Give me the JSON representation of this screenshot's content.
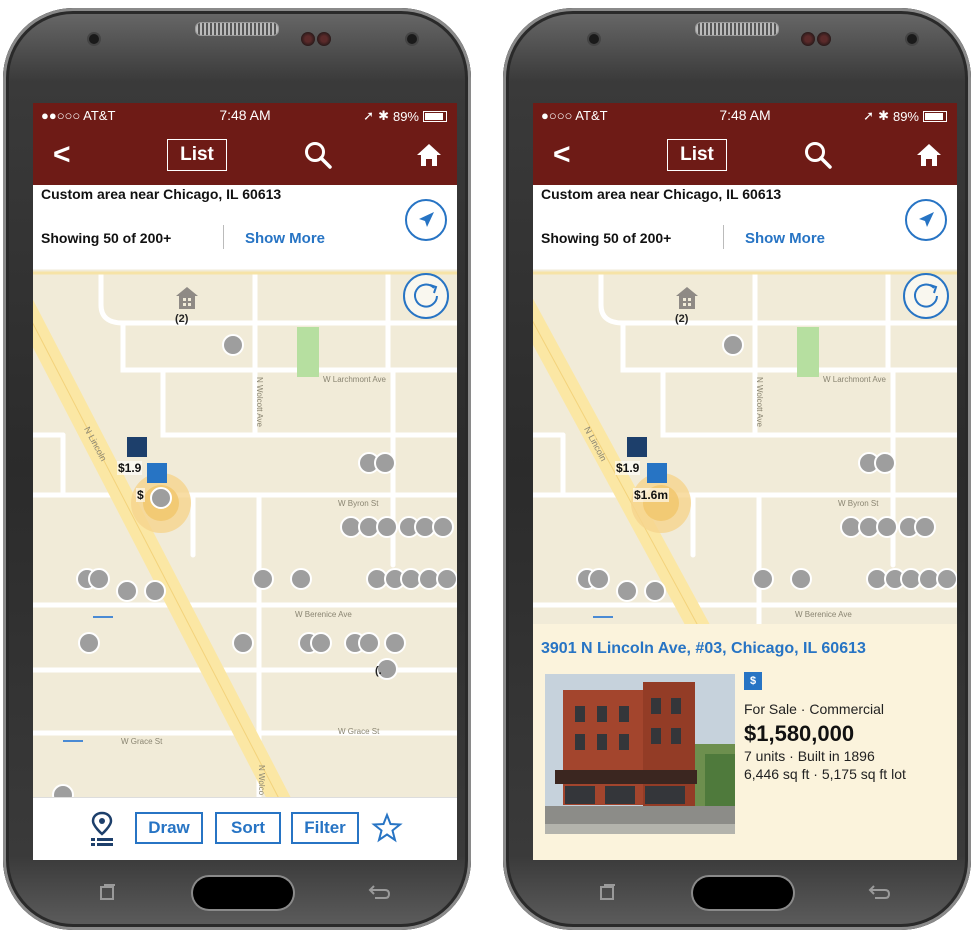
{
  "phones": [
    {
      "status": {
        "carrier": "●●○○○ AT&T",
        "time": "7:48 AM",
        "battery": "89%"
      },
      "nav": {
        "back": "<",
        "list_label": "List"
      },
      "info": {
        "title": "Custom area near Chicago, IL 60613",
        "count": "Showing 50 of 200+",
        "more": "Show More"
      },
      "map": {
        "cluster_count": "(2)",
        "price_1": "$1.9",
        "price_2": "$",
        "partial_label": "(.",
        "streets": {
          "larchmont": "W Larchmont Ave",
          "byron": "W Byron St",
          "berenice": "W Berenice Ave",
          "grace_a": "W Grace St",
          "grace_b": "W Grace St",
          "lincoln": "N Lincoln",
          "wolcott": "N Wolcott Ave",
          "wolcott_b": "N Wolco"
        }
      },
      "toolbar": {
        "draw": "Draw",
        "sort": "Sort",
        "filter": "Filter"
      }
    },
    {
      "status": {
        "carrier": "●○○○ AT&T",
        "time": "7:48 AM",
        "battery": "89%"
      },
      "nav": {
        "back": "<",
        "list_label": "List"
      },
      "info": {
        "title": "Custom area near Chicago, IL 60613",
        "count": "Showing 50 of 200+",
        "more": "Show More"
      },
      "map": {
        "cluster_count": "(2)",
        "price_1": "$1.9",
        "price_2": "$1.6m",
        "streets": {
          "larchmont": "W Larchmont Ave",
          "byron": "W Byron St",
          "berenice": "W Berenice Ave",
          "lincoln": "N Lincoln",
          "wolcott": "N Wolcott Ave"
        }
      },
      "detail": {
        "address": "3901 N Lincoln Ave, #03, Chicago, IL 60613",
        "badge": "$",
        "type": "For Sale · Commercial",
        "price": "$1,580,000",
        "units": "7 units · Built in 1896",
        "size": "6,446 sq ft · 5,175 sq ft lot"
      }
    }
  ],
  "colors": {
    "brand": "#6e1b16",
    "accent": "#2774c4",
    "map_bg": "#f1ebd8",
    "park": "#b6dfa0"
  }
}
